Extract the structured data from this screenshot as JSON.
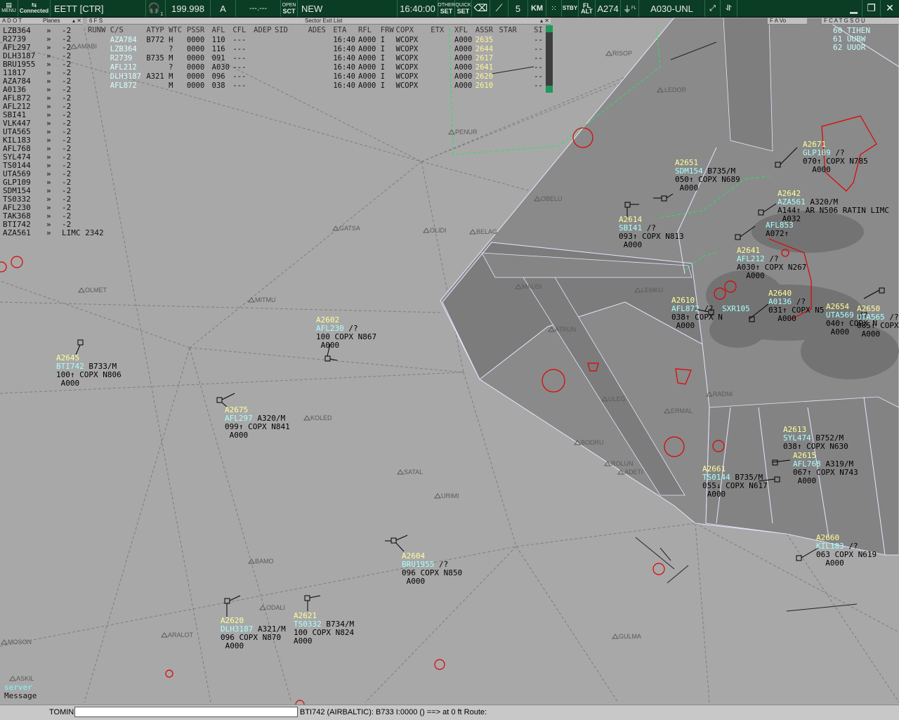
{
  "toolbar": {
    "menu_label": "MENU",
    "connection_status": "Connected",
    "sector_label": "EETT [CTR]",
    "frequency": "199.998",
    "atis": "A",
    "secondary_freq": "---.---",
    "open_sct_label": "OPEN",
    "open_sct_sub": "SCT",
    "mode_label": "NEW",
    "clock": "16:40:00",
    "other_set": "OTHER",
    "other_set_sub": "SET",
    "quick_set": "QUICK",
    "quick_set_sub": "SET",
    "range_value": "5",
    "range_unit": "KM",
    "stby_label": "STBY",
    "fl_alt_label": "FL",
    "fl_alt_sub": "ALT",
    "altitude_setting": "A274",
    "filter_range": "A030-UNL",
    "headset_index": "1",
    "fl_filter_label": "FL"
  },
  "panels": {
    "adot_title": "A D O T",
    "planes_title": "Planes",
    "sel_title_left": "6 F S",
    "sel_title": "Sector Exit List",
    "right_title_a": "F A Vo",
    "right_title_b": "F C A T G S O U"
  },
  "adot_list": [
    {
      "callsign": "LZB364",
      "arrow": "»",
      "value": "-2"
    },
    {
      "callsign": "R2739",
      "arrow": "»",
      "value": "-2"
    },
    {
      "callsign": "AFL297",
      "arrow": "»",
      "value": "-2"
    },
    {
      "callsign": "DLH3187",
      "arrow": "»",
      "value": "-2"
    },
    {
      "callsign": "BRU1955",
      "arrow": "»",
      "value": "-2"
    },
    {
      "callsign": "11817",
      "arrow": "»",
      "value": "-2"
    },
    {
      "callsign": "AZA784",
      "arrow": "»",
      "value": "-2"
    },
    {
      "callsign": "A0136",
      "arrow": "»",
      "value": "-2"
    },
    {
      "callsign": "AFL872",
      "arrow": "»",
      "value": "-2"
    },
    {
      "callsign": "AFL212",
      "arrow": "»",
      "value": "-2"
    },
    {
      "callsign": "SBI41",
      "arrow": "»",
      "value": "-2"
    },
    {
      "callsign": "VLK447",
      "arrow": "»",
      "value": "-2"
    },
    {
      "callsign": "UTA565",
      "arrow": "»",
      "value": "-2"
    },
    {
      "callsign": "KIL183",
      "arrow": "»",
      "value": "-2"
    },
    {
      "callsign": "AFL768",
      "arrow": "»",
      "value": "-2"
    },
    {
      "callsign": "SYL474",
      "arrow": "»",
      "value": "-2"
    },
    {
      "callsign": "TS0144",
      "arrow": "»",
      "value": "-2"
    },
    {
      "callsign": "UTA569",
      "arrow": "»",
      "value": "-2"
    },
    {
      "callsign": "GLP109",
      "arrow": "»",
      "value": "-2"
    },
    {
      "callsign": "SDM154",
      "arrow": "»",
      "value": "-2"
    },
    {
      "callsign": "TS0332",
      "arrow": "»",
      "value": "-2"
    },
    {
      "callsign": "AFL230",
      "arrow": "»",
      "value": "-2"
    },
    {
      "callsign": "TAK368",
      "arrow": "»",
      "value": "-2"
    },
    {
      "callsign": "BTI742",
      "arrow": "»",
      "value": "-2"
    },
    {
      "callsign": "AZA561",
      "arrow": "»",
      "value": "LIMC 2342"
    }
  ],
  "selection_list": {
    "headers": [
      "RUNW",
      "C/S",
      "ATYP",
      "WTC",
      "PSSR",
      "AFL",
      "CFL",
      "ADEP",
      "SID",
      "ADES",
      "ETA",
      "RFL",
      "FRW",
      "COPX",
      "ETX",
      "XFL",
      "ASSR",
      "STAR",
      "SI"
    ],
    "rows": [
      {
        "cs": "AZA784",
        "atyp": "B772",
        "wtc": "H",
        "pssr": "0000",
        "afl": "110",
        "cfl": "---",
        "eta": "16:40",
        "rfl": "A000",
        "frw": "I",
        "copx": "WCOPX",
        "xfl": "A000",
        "assr": "2635",
        "si": "--"
      },
      {
        "cs": "LZB364",
        "atyp": "",
        "wtc": "?",
        "pssr": "0000",
        "afl": "116",
        "cfl": "---",
        "eta": "16:40",
        "rfl": "A000",
        "frw": "I",
        "copx": "WCOPX",
        "xfl": "A000",
        "assr": "2644",
        "si": "--"
      },
      {
        "cs": "R2739",
        "atyp": "B735",
        "wtc": "M",
        "pssr": "0000",
        "afl": "091",
        "cfl": "---",
        "eta": "16:40",
        "rfl": "A000",
        "frw": "I",
        "copx": "WCOPX",
        "xfl": "A000",
        "assr": "2617",
        "si": "--"
      },
      {
        "cs": "AFL212",
        "atyp": "",
        "wtc": "?",
        "pssr": "0000",
        "afl": "A030",
        "cfl": "---",
        "eta": "16:40",
        "rfl": "A000",
        "frw": "I",
        "copx": "WCOPX",
        "xfl": "A000",
        "assr": "2641",
        "si": "--"
      },
      {
        "cs": "DLH3187",
        "atyp": "A321",
        "wtc": "M",
        "pssr": "0000",
        "afl": "096",
        "cfl": "---",
        "eta": "16:40",
        "rfl": "A000",
        "frw": "I",
        "copx": "WCOPX",
        "xfl": "A000",
        "assr": "2620",
        "si": "--"
      },
      {
        "cs": "AFL872",
        "atyp": "",
        "wtc": "M",
        "pssr": "0000",
        "afl": "038",
        "cfl": "---",
        "eta": "16:40",
        "rfl": "A000",
        "frw": "I",
        "copx": "WCOPX",
        "xfl": "A000",
        "assr": "2610",
        "si": "--"
      }
    ]
  },
  "fpl_right": [
    "60 TIHEN",
    "61 UUBW",
    "62 UUOR"
  ],
  "waypoints": [
    {
      "name": "AMABI",
      "id": "wp-amabi"
    },
    {
      "name": "RISOP",
      "id": "wp-risop"
    },
    {
      "name": "LEDOR",
      "id": "wp-ledor"
    },
    {
      "name": "PENUR",
      "id": "wp-penur"
    },
    {
      "name": "OBELU",
      "id": "wp-obelu"
    },
    {
      "name": "GATSA",
      "id": "wp-gatsa"
    },
    {
      "name": "OLIDI",
      "id": "wp-olidi"
    },
    {
      "name": "BELAG",
      "id": "wp-belag"
    },
    {
      "name": "OLMET",
      "id": "wp-olmet"
    },
    {
      "name": "MITMU",
      "id": "wp-mitmu"
    },
    {
      "name": "MAUSI",
      "id": "wp-mausi"
    },
    {
      "name": "LEMKU",
      "id": "wp-lemku"
    },
    {
      "name": "ATRUN",
      "id": "wp-atrun"
    },
    {
      "name": "KOLED",
      "id": "wp-koled"
    },
    {
      "name": "SATAL",
      "id": "wp-satal"
    },
    {
      "name": "URIMI",
      "id": "wp-urimi"
    },
    {
      "name": "BAMO",
      "id": "wp-bamo"
    },
    {
      "name": "ODALI",
      "id": "wp-odali"
    },
    {
      "name": "ARALOT",
      "id": "wp-aralot"
    },
    {
      "name": "MOSON",
      "id": "wp-moson"
    },
    {
      "name": "ASKIL",
      "id": "wp-askil"
    },
    {
      "name": "GULMA",
      "id": "wp-gulma"
    },
    {
      "name": "ULEG",
      "id": "wp-uleg"
    },
    {
      "name": "BODRU",
      "id": "wp-bodru"
    },
    {
      "name": "ROLUN",
      "id": "wp-rolun"
    },
    {
      "name": "ADETI",
      "id": "wp-adeti"
    },
    {
      "name": "ERMAL",
      "id": "wp-ermal"
    },
    {
      "name": "RADNI",
      "id": "wp-radni"
    }
  ],
  "tracks": [
    {
      "ssr": "A2645",
      "cs": "BTI742",
      "type": "B733/M",
      "l3": "100↑ COPX N806",
      "l4": " A000"
    },
    {
      "ssr": "A2602",
      "cs": "AFL230",
      "type": "/?",
      "l3": "100 COPX N867",
      "l4": " A000"
    },
    {
      "ssr": "A2675",
      "cs": "AFL297",
      "type": "A320/M",
      "l3": "099↑ COPX N841",
      "l4": " A000"
    },
    {
      "ssr": "A2604",
      "cs": "BRU1955",
      "type": "/?",
      "l3": "096 COPX N850",
      "l4": " A000"
    },
    {
      "ssr": "A2620",
      "cs": "DLH3187",
      "type": "A321/M",
      "l3": "096 COPX N870",
      "l4": " A000"
    },
    {
      "ssr": "A2621",
      "cs": "TS0332",
      "type": "B734/M",
      "l3": "100 COPX N824",
      "l4": "A000"
    },
    {
      "ssr": "A2651",
      "cs": "SDM154",
      "type": "B735/M",
      "l3": "050↑ COPX N689",
      "l4": " A000"
    },
    {
      "ssr": "A2671",
      "cs": "GLP109",
      "type": "/?",
      "l3": "070↑ COPX N785",
      "l4": "  A000"
    },
    {
      "ssr": "A2642",
      "cs": "AZA561",
      "type": "A320/M",
      "l3": "A144↑ AR N506 RATIN LIMC",
      "l4": " A032"
    },
    {
      "ssr": "A2614",
      "cs": "SBI41",
      "type": "/?",
      "l3": "093↑ COPX N813",
      "l4": " A000"
    },
    {
      "ssr": "",
      "cs": "AFL853",
      "type": "",
      "l3": "A072↑",
      "l4": ""
    },
    {
      "ssr": "A2641",
      "cs": "AFL212",
      "type": "/?",
      "l3": "A030↑ COPX N267",
      "l4": "  A000"
    },
    {
      "ssr": "A2610",
      "cs": "AFL872",
      "type": "/?",
      "l3": "038↑ COPX N",
      "l4": " A000"
    },
    {
      "ssr": "A2640",
      "cs": "A0136",
      "type": "/?",
      "l3": "031↑ COPX N5",
      "l4": "  A000"
    },
    {
      "ssr": "",
      "cs": "SXR105",
      "type": "",
      "l3": "",
      "l4": ""
    },
    {
      "ssr": "A2654",
      "cs": "UTA569",
      "type": "/?",
      "l3": "040↑ COPX N",
      "l4": " A000"
    },
    {
      "ssr": "A2650",
      "cs": "UTA565",
      "type": "/?",
      "l3": "065↑ COPX",
      "l4": " A000"
    },
    {
      "ssr": "A2613",
      "cs": "SYL474",
      "type": "B752/M",
      "l3": "038↑ COPX N630",
      "l4": ""
    },
    {
      "ssr": "A2615",
      "cs": "AFL768",
      "type": "A319/M",
      "l3": "067↑ COPX N743",
      "l4": " A000"
    },
    {
      "ssr": "A2661",
      "cs": "TS0144",
      "type": "B735/M",
      "l3": "055↓ COPX N617",
      "l4": " A000"
    },
    {
      "ssr": "A2660",
      "cs": "KIL183",
      "type": "/?",
      "l3": "063 COPX N619",
      "l4": "  A000"
    }
  ],
  "message_area": {
    "server": "server",
    "message": "Message"
  },
  "statusbar": {
    "cmd_label": "TOMIN",
    "cmd_value": "",
    "info": "BTI742 (AIRBALTIC): B733 I:0000 () ==> at 0 ft Route:"
  },
  "colors": {
    "background": "#a8a8a8",
    "sector_fill": "#898989",
    "sector_border": "#e6e6ff",
    "route_line": "#7a7a7a",
    "ssr_code": "#ffff9a",
    "callsign": "#a8ffff",
    "restricted_area": "#e00000",
    "boundary_green": "#2fdc6a",
    "toolbar_bg": "#0b3d24"
  }
}
